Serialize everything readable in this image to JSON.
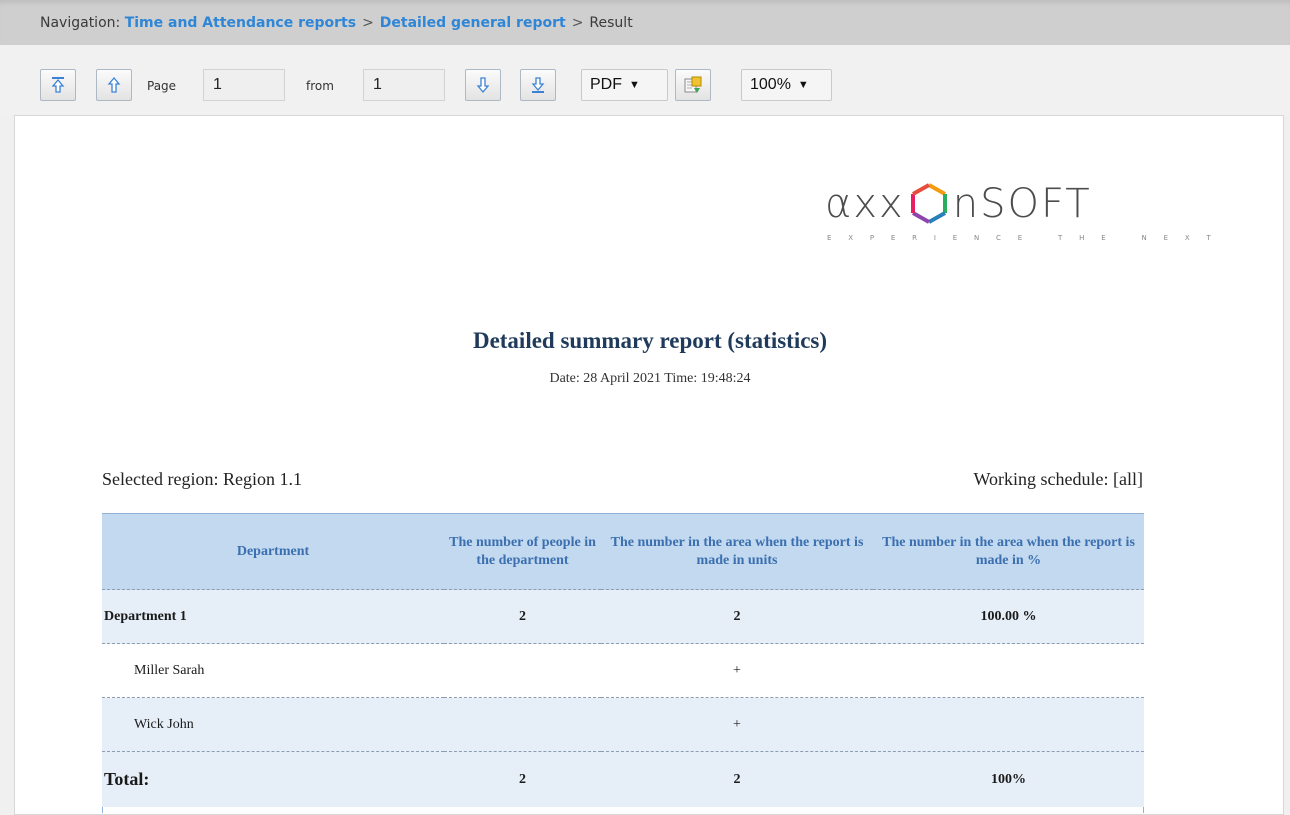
{
  "navigation": {
    "prefix": "Navigation:",
    "crumbs": [
      "Time and Attendance reports",
      "Detailed general report"
    ],
    "separator": ">",
    "current": "Result"
  },
  "toolbar": {
    "page_label": "Page",
    "page_value": "1",
    "from_label": "from",
    "from_value": "1",
    "format_selected": "PDF",
    "zoom_selected": "100%",
    "icons": [
      "first-page-icon",
      "previous-page-icon",
      "next-page-icon",
      "last-page-icon",
      "export-icon"
    ]
  },
  "report": {
    "logo_word": "axxonsoft",
    "logo_tagline": "EXPERIENCE THE NEXT",
    "title": "Detailed summary report (statistics)",
    "date_line": "Date: 28 April 2021 Time: 19:48:24",
    "region": "Selected region: Region 1.1",
    "schedule": "Working schedule: [all]",
    "table": {
      "headers": [
        "Department",
        "The number of people in the department",
        "The number in the area when the report is made in units",
        "The number in the area when the report is made in %"
      ],
      "department": {
        "name": "Department 1",
        "people": "2",
        "units": "2",
        "percent": "100.00 %"
      },
      "employees": [
        {
          "name": "Miller Sarah",
          "mark": "+"
        },
        {
          "name": "Wick John",
          "mark": "+"
        }
      ],
      "total": {
        "label": "Total:",
        "people": "2",
        "units": "2",
        "percent": "100%"
      }
    }
  },
  "colors": {
    "accent_link": "#2f86d6",
    "header_bg": "#c2d9ef",
    "header_text": "#3b6fb0",
    "title_text": "#1f3a5a"
  }
}
